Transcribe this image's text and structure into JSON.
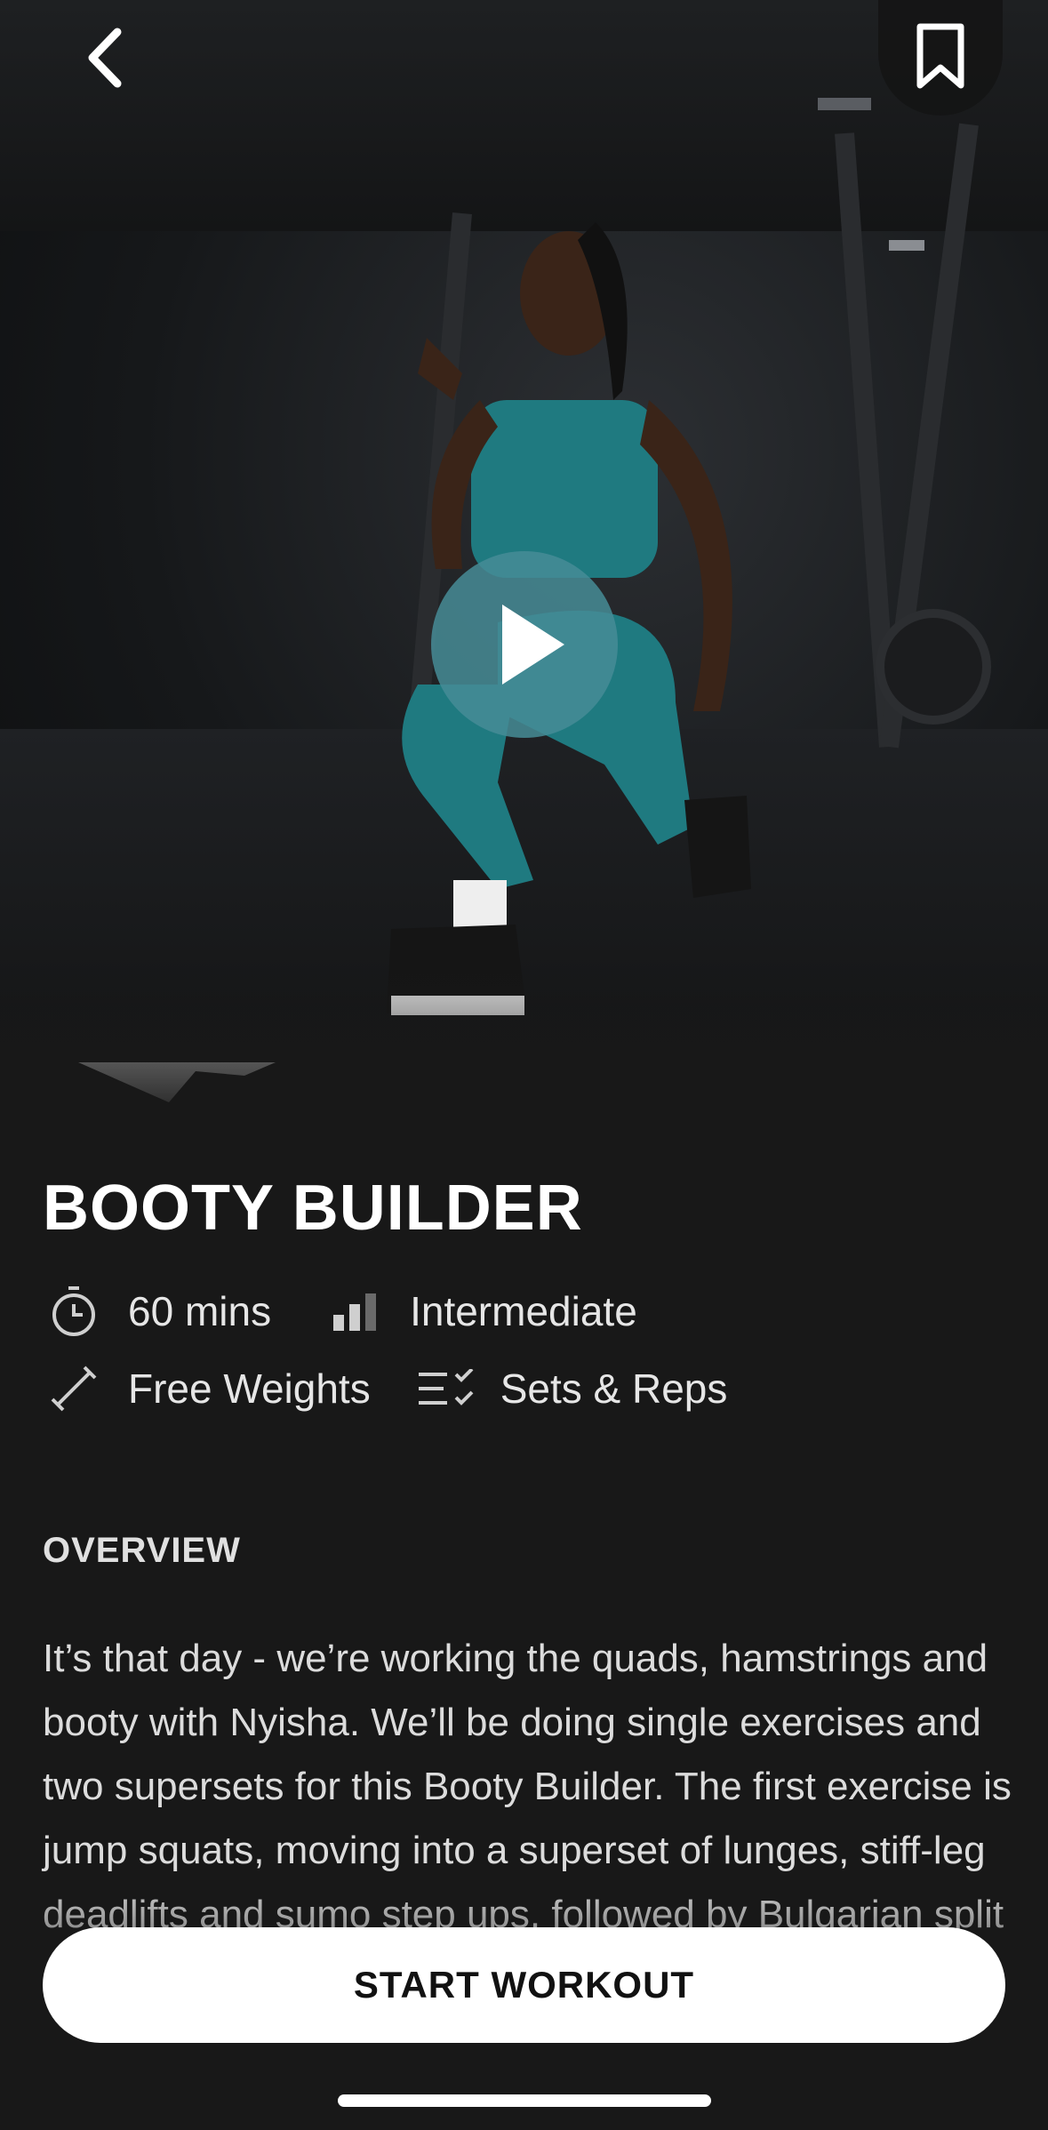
{
  "workout": {
    "title": "BOOTY BUILDER",
    "duration": "60 mins",
    "level": "Intermediate",
    "equipment": "Free Weights",
    "format": "Sets & Reps"
  },
  "overview": {
    "label": "OVERVIEW",
    "text": "It’s that day - we’re working the quads, hamstrings and booty with Nyisha. We’ll be doing single exercises and two supersets for this Booty Builder. The first exercise is jump squats, moving into a superset of lunges, stiff-leg deadlifts and sumo step ups, followed by Bulgarian split squats and hip thrusts. You ready to build?"
  },
  "actions": {
    "start_label": "START WORKOUT"
  },
  "icons": {
    "back": "chevron-left-icon",
    "bookmark": "bookmark-icon",
    "play": "play-icon",
    "duration": "stopwatch-icon",
    "level": "bars-icon",
    "equipment": "dumbbell-icon",
    "format": "checklist-icon"
  },
  "colors": {
    "background": "#181818",
    "play_button": "#468c96",
    "outfit": "#1f7a80",
    "start_button": "#ffffff"
  }
}
